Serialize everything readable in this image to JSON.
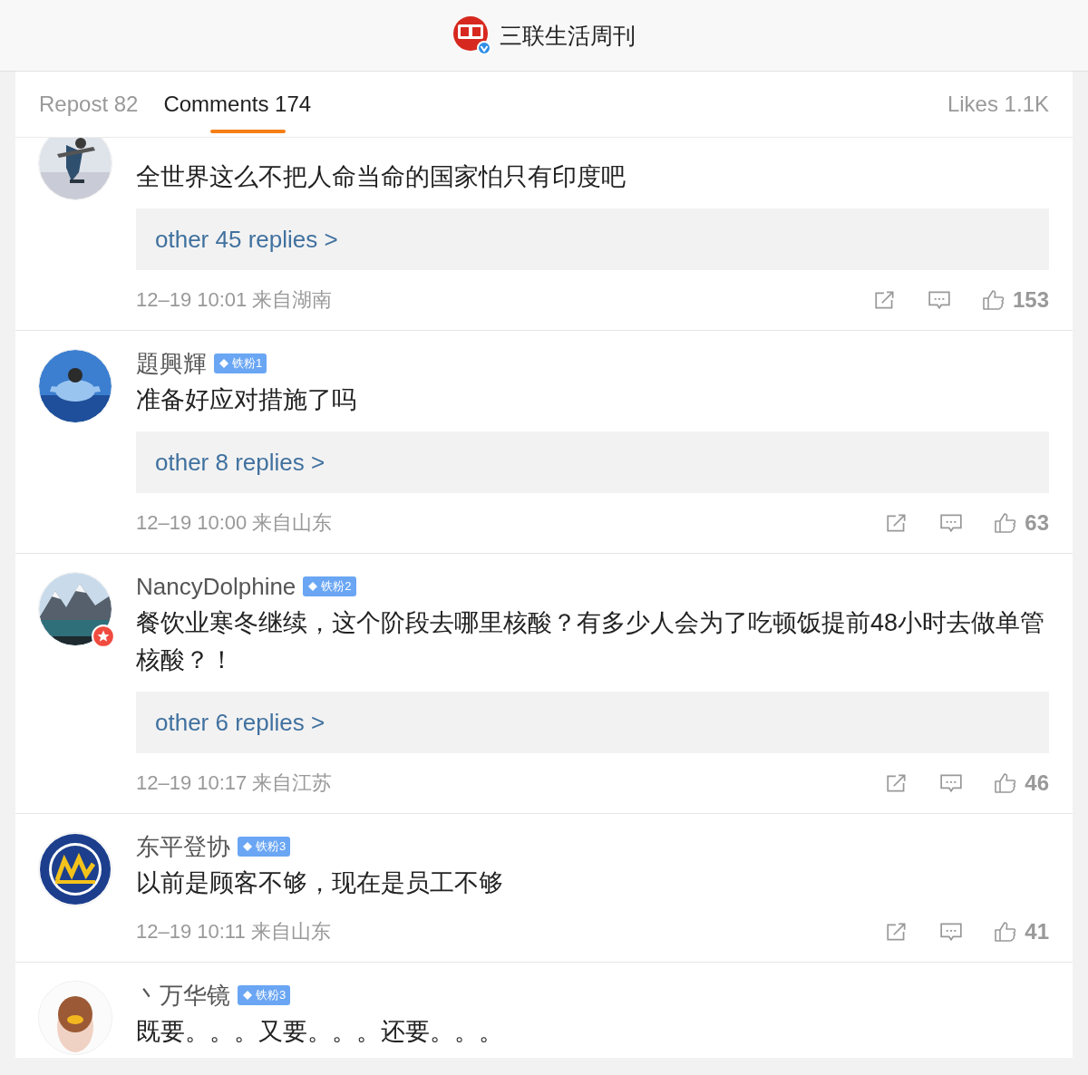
{
  "header": {
    "account": "三联生活周刊"
  },
  "tabs": [
    {
      "label": "Repost 82",
      "selected": false
    },
    {
      "label": "Comments 174",
      "selected": true
    }
  ],
  "likes": "Likes 1.1K",
  "comments": [
    {
      "avatar": {
        "kind": "snow"
      },
      "vip": false,
      "text": "全世界这么不把人命当命的国家怕只有印度吧",
      "replies": "other 45 replies >",
      "time": "12–19 10:01 来自湖南",
      "likes": "153"
    },
    {
      "avatar": {
        "kind": "person"
      },
      "vip": false,
      "name": "題興輝",
      "badge": "铁粉1",
      "text": "准备好应对措施了吗",
      "replies": "other 8 replies >",
      "time": "12–19 10:00 来自山东",
      "likes": "63"
    },
    {
      "avatar": {
        "kind": "mountain"
      },
      "vip": true,
      "name": "NancyDolphine",
      "badge": "铁粉2",
      "text": "餐饮业寒冬继续，这个阶段去哪里核酸？有多少人会为了吃顿饭提前48小时去做单管核酸？！",
      "replies": "other 6 replies >",
      "time": "12–19 10:17 来自江苏",
      "likes": "46"
    },
    {
      "avatar": {
        "kind": "logo"
      },
      "vip": false,
      "name": "东平登协",
      "badge": "铁粉3",
      "text": "以前是顾客不够，现在是员工不够",
      "time": "12–19 10:11 来自山东",
      "likes": "41"
    },
    {
      "avatar": {
        "kind": "cartoon"
      },
      "vip": false,
      "name": "丶万华镜",
      "badge": "铁粉3",
      "text": "既要。。。又要。。。还要。。。"
    }
  ]
}
